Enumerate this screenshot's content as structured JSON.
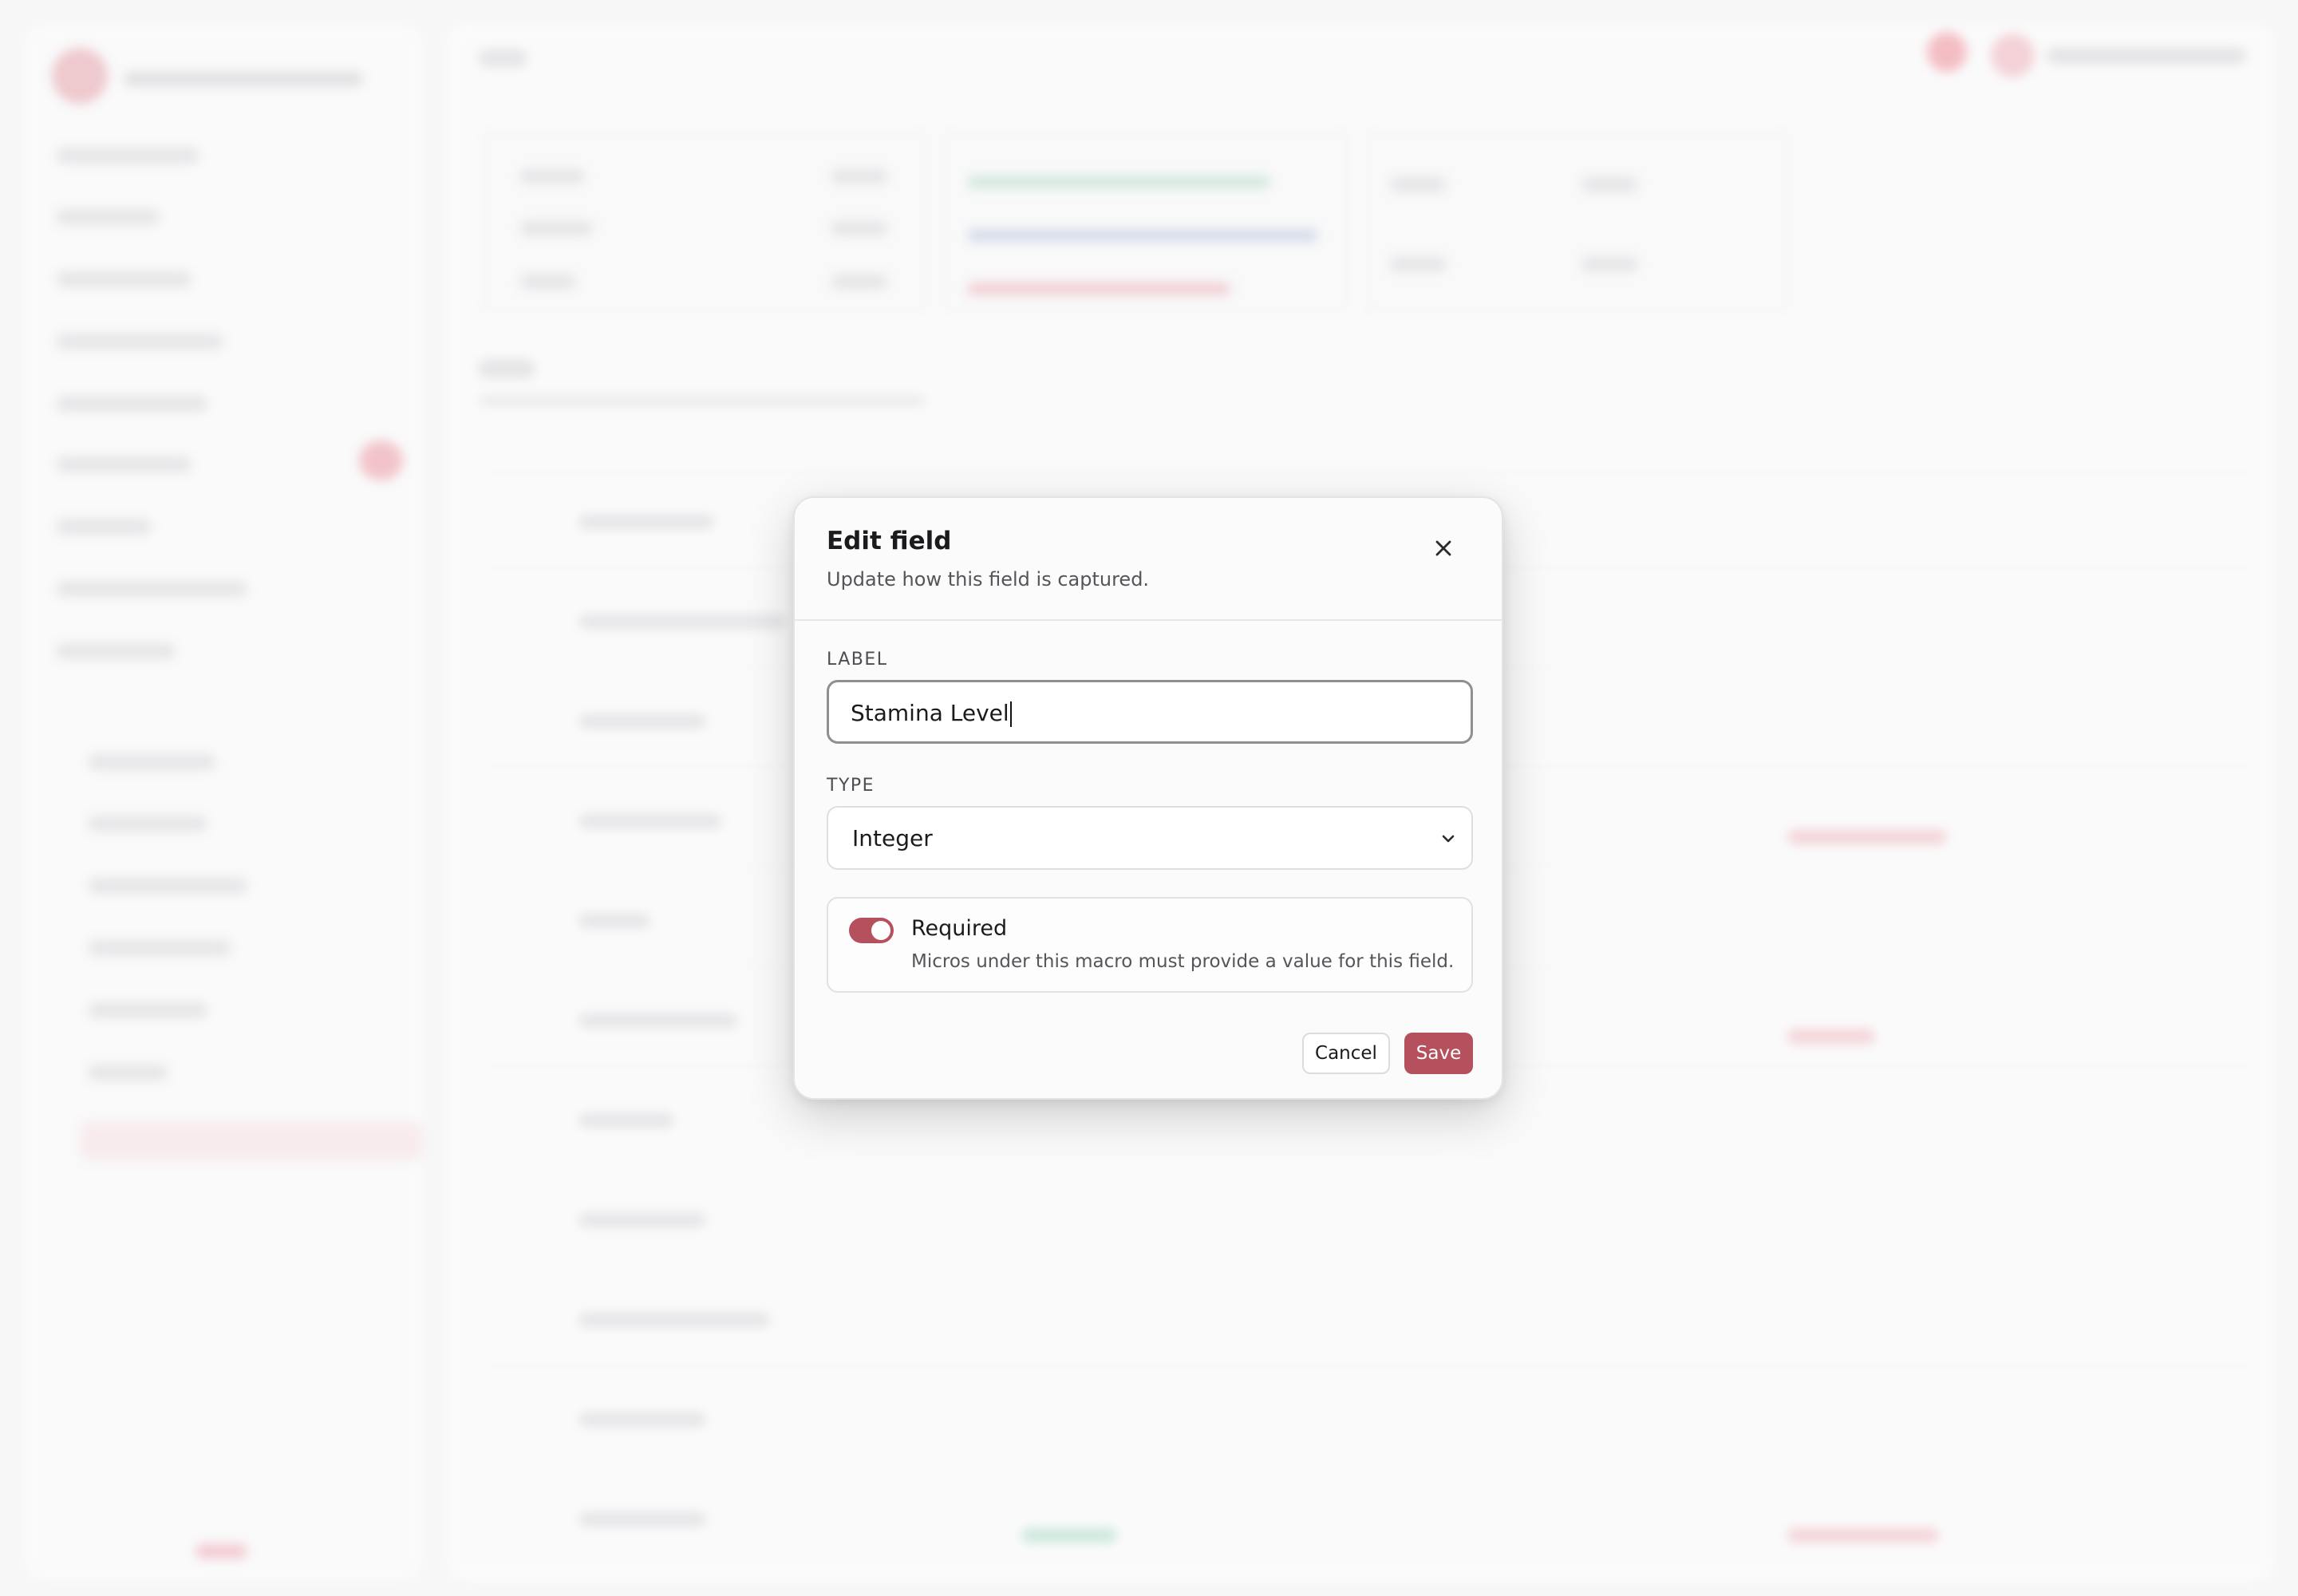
{
  "modal": {
    "title": "Edit field",
    "subtitle": "Update how this field is captured.",
    "label_section": "LABEL",
    "label_value": "Stamina Level",
    "type_section": "TYPE",
    "type_selected": "Integer",
    "required_label": "Required",
    "required_help": "Micros under this macro must provide a value for this field.",
    "required_on": true,
    "cancel_label": "Cancel",
    "save_label": "Save",
    "accent": "#b5505d"
  },
  "icons": {
    "close": "close-icon",
    "select": "chevron-down-icon"
  }
}
